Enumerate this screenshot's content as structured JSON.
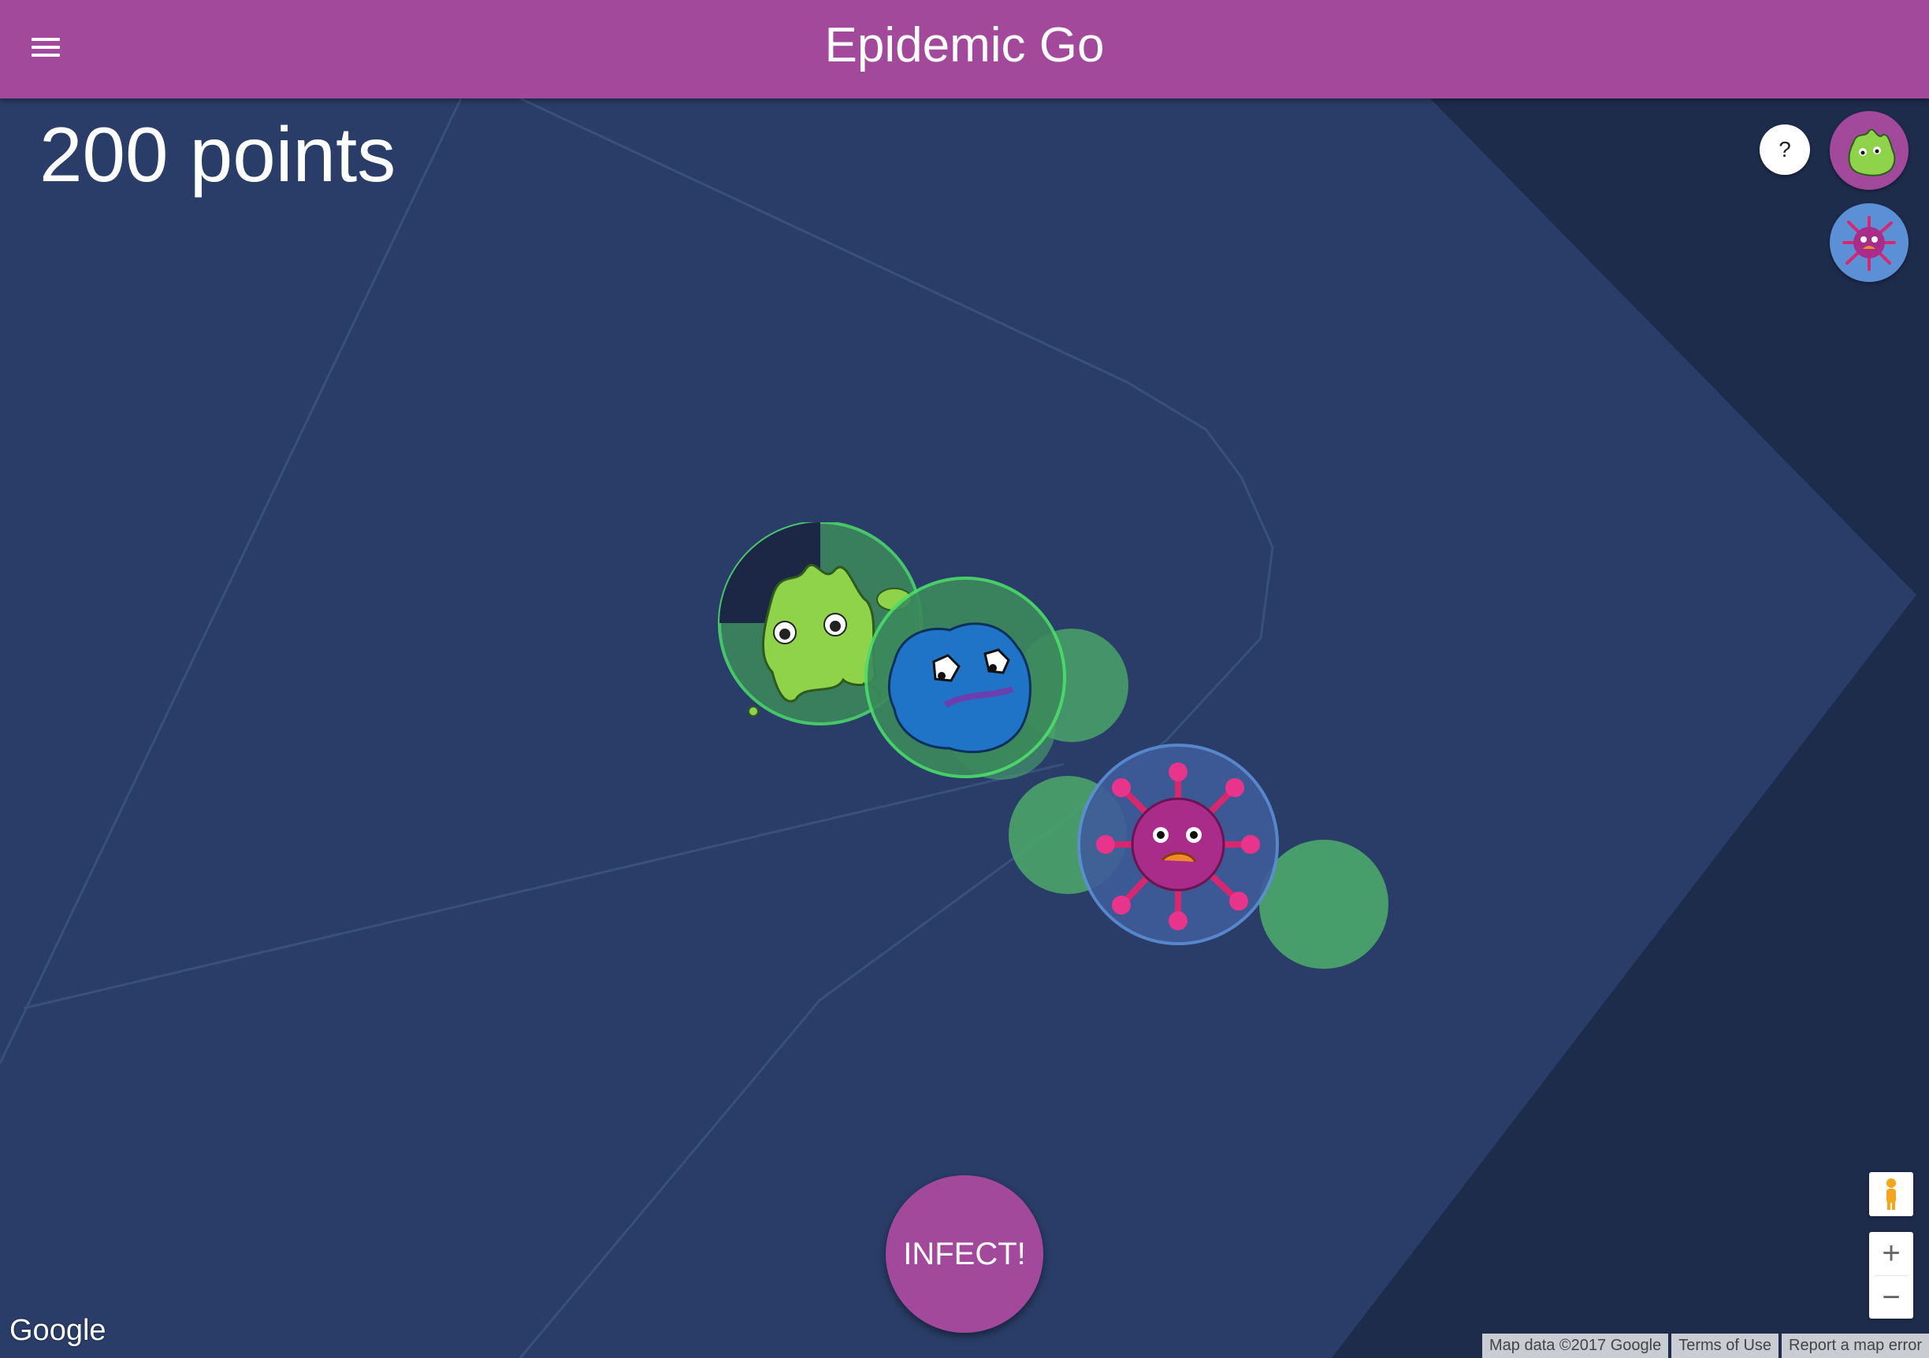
{
  "app": {
    "title": "Epidemic Go"
  },
  "score": {
    "text": "200 points"
  },
  "controls": {
    "help_label": "?",
    "infect_label": "INFECT!",
    "zoom_in": "+",
    "zoom_out": "−"
  },
  "players": [
    {
      "name": "green-slime",
      "bg": "#a2499b"
    },
    {
      "name": "pink-virus",
      "bg": "#5b8fd6"
    }
  ],
  "map": {
    "logo": "Google",
    "attribution": [
      "Map data ©2017 Google",
      "Terms of Use",
      "Report a map error"
    ],
    "colors": {
      "land": "#2a3d68",
      "water": "#1e2c4c",
      "road": "#38507c"
    }
  },
  "colors": {
    "accent": "#a2499b",
    "team_green": "#4cde6a",
    "team_blue": "#5b8fd6",
    "glow": "#4aa36a"
  }
}
